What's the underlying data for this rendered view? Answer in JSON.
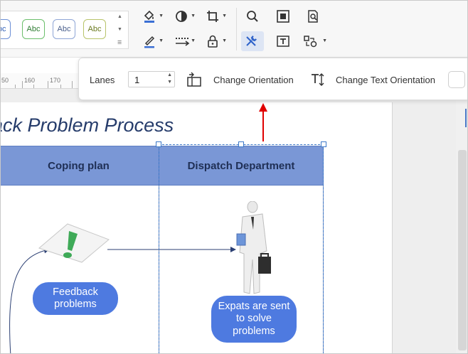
{
  "style_gallery": {
    "samples": [
      {
        "label": "Abc",
        "border": "#6b8fd6",
        "color": "#2f5fb8"
      },
      {
        "label": "Abc",
        "border": "#6cbf6c",
        "color": "#2e7d32"
      },
      {
        "label": "Abc",
        "border": "#8fa6d6",
        "color": "#4a5f8c"
      },
      {
        "label": "Abc",
        "border": "#b8c46a",
        "color": "#6b7a1f"
      }
    ]
  },
  "toolbar": {
    "icons": [
      "fill-icon",
      "shape-style-icon",
      "crop-icon",
      "search-icon",
      "fit-page-icon",
      "find-replace-icon",
      "line-color-icon",
      "line-style-icon",
      "lock-icon",
      "tools-icon",
      "text-box-icon",
      "shape-transform-icon"
    ]
  },
  "ruler": {
    "ticks": [
      "50",
      "160",
      "170"
    ]
  },
  "diagram": {
    "title": "ack Problem Process",
    "lanes": [
      "Coping plan",
      "Dispatch Department"
    ],
    "bubble_left": "Feedback problems",
    "bubble_right": "Expats are sent to solve problems"
  },
  "context_bar": {
    "lanes_label": "Lanes",
    "lanes_value": "1",
    "change_orientation": "Change Orientation",
    "change_text_orientation": "Change Text Orientation"
  },
  "colors": {
    "accent": "#3c78c8",
    "lane_header": "#7a97d6",
    "bubble": "#4e7ae0",
    "arrow_red": "#e00000"
  }
}
